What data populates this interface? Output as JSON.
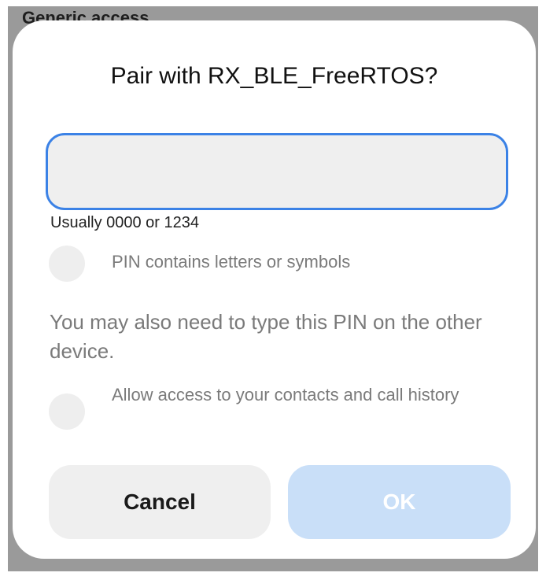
{
  "background": {
    "header_text": "Generic access"
  },
  "dialog": {
    "title": "Pair with RX_BLE_FreeRTOS?",
    "pin_input": {
      "value": "",
      "placeholder": ""
    },
    "hint": "Usually 0000 or 1234",
    "option_letters": {
      "label": "PIN contains letters or symbols",
      "checked": false
    },
    "note": "You may also need to type this PIN on the other device.",
    "option_contacts": {
      "label": "Allow access to your contacts and call history",
      "checked": false
    },
    "buttons": {
      "cancel": "Cancel",
      "ok": "OK",
      "ok_enabled": false
    }
  },
  "colors": {
    "accent": "#3b82e6",
    "ok_disabled_bg": "#c9dff8",
    "scrim": "#9a9a9a"
  }
}
